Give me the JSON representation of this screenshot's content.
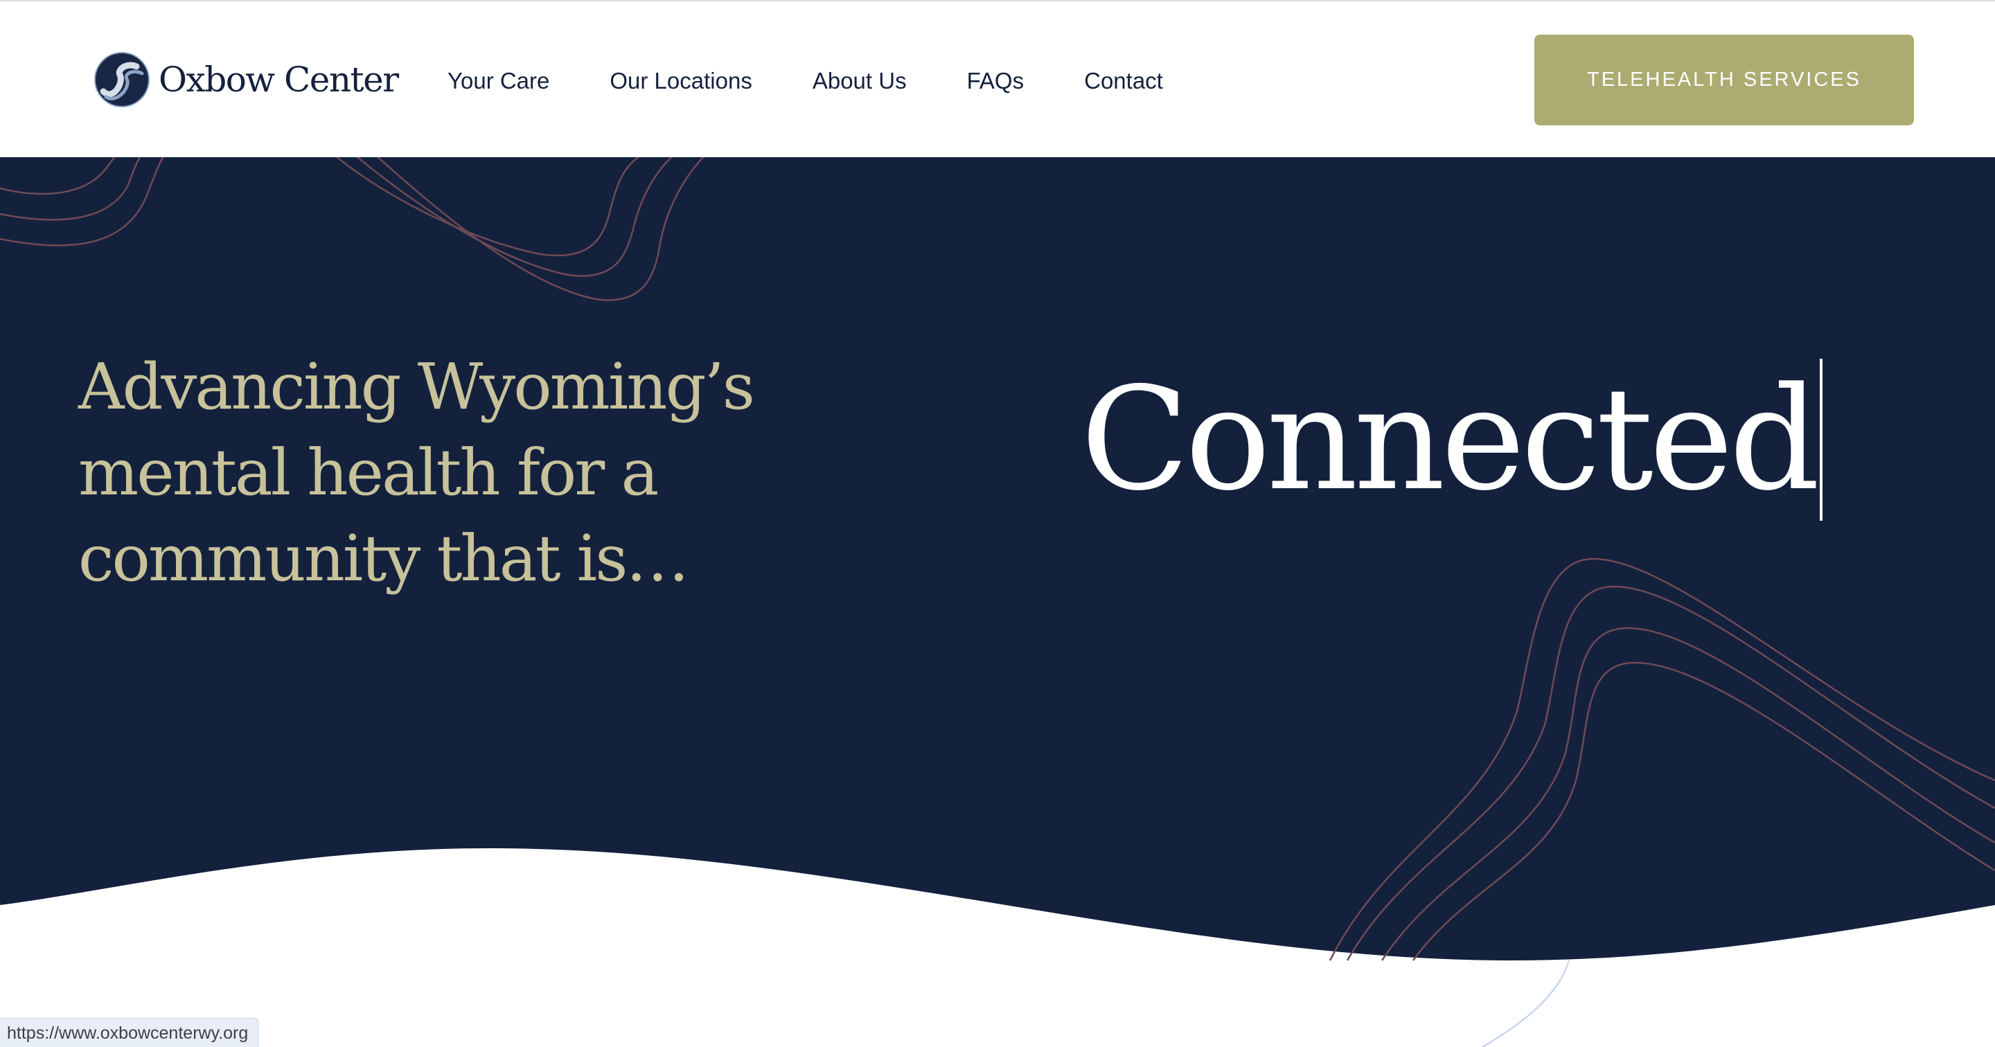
{
  "header": {
    "logo_text": "Oxbow Center",
    "nav": [
      {
        "label": "Your Care"
      },
      {
        "label": "Our Locations"
      },
      {
        "label": "About Us"
      },
      {
        "label": "FAQs"
      },
      {
        "label": "Contact"
      }
    ],
    "cta_label": "TELEHEALTH SERVICES"
  },
  "hero": {
    "tagline": "Advancing Wyoming’s mental health for a community that is…",
    "rotating_word": "Connected"
  },
  "status_bar": {
    "url": "https://www.oxbowcenterwy.org"
  },
  "colors": {
    "navy": "#14213d",
    "olive_button": "#acab72",
    "tagline_gold": "#c7c29a",
    "decorative_lines": "#6e4a56",
    "white": "#ffffff"
  },
  "icons": {
    "logo_mark": "oxbow-river-logo-icon"
  }
}
